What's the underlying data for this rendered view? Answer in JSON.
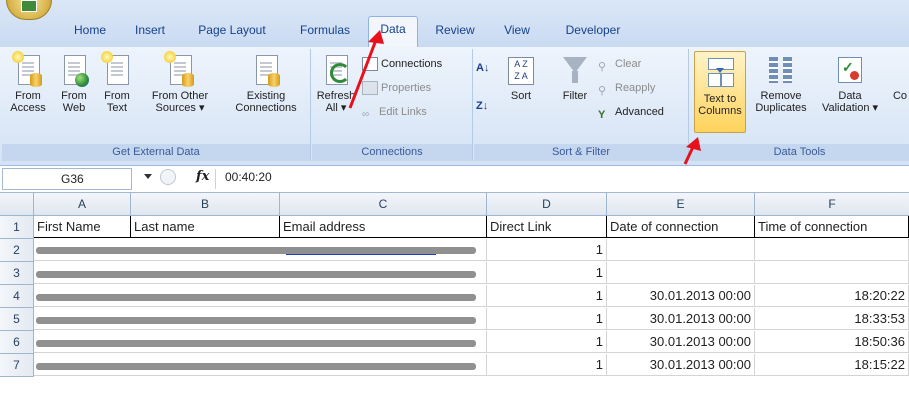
{
  "tabs": [
    "Home",
    "Insert",
    "Page Layout",
    "Formulas",
    "Data",
    "Review",
    "View",
    "Developer"
  ],
  "active_tab": "Data",
  "ribbon": {
    "get_external": {
      "label": "Get External Data",
      "from_access": [
        "From",
        "Access"
      ],
      "from_web": [
        "From",
        "Web"
      ],
      "from_text": [
        "From",
        "Text"
      ],
      "from_other": [
        "From Other",
        "Sources ▾"
      ],
      "existing": [
        "Existing",
        "Connections"
      ]
    },
    "connections": {
      "label": "Connections",
      "refresh": [
        "Refresh",
        "All ▾"
      ],
      "connections": "Connections",
      "properties": "Properties",
      "edit_links": "Edit Links"
    },
    "sort_filter": {
      "label": "Sort & Filter",
      "sort": "Sort",
      "filter": "Filter",
      "clear": "Clear",
      "reapply": "Reapply",
      "advanced": "Advanced"
    },
    "data_tools": {
      "label": "Data Tools",
      "text_to_columns": [
        "Text to",
        "Columns"
      ],
      "remove_duplicates": [
        "Remove",
        "Duplicates"
      ],
      "data_validation": [
        "Data",
        "Validation ▾"
      ],
      "cutoff": "Co"
    }
  },
  "formula_bar": {
    "name_box": "G36",
    "fx": "fx",
    "value": "00:40:20"
  },
  "columns": [
    "A",
    "B",
    "C",
    "D",
    "E",
    "F"
  ],
  "header_row": [
    "First Name",
    "Last name",
    "Email address",
    "Direct Link",
    "Date of connection",
    "Time of connection"
  ],
  "rows": [
    {
      "num": "1"
    },
    {
      "num": "2",
      "d": "1",
      "e": "",
      "f": ""
    },
    {
      "num": "3",
      "d": "1",
      "e": "",
      "f": ""
    },
    {
      "num": "4",
      "d": "1",
      "e": "30.01.2013 00:00",
      "f": "18:20:22"
    },
    {
      "num": "5",
      "d": "1",
      "e": "30.01.2013 00:00",
      "f": "18:33:53"
    },
    {
      "num": "6",
      "d": "1",
      "e": "30.01.2013 00:00",
      "f": "18:50:36"
    },
    {
      "num": "7",
      "d": "1",
      "e": "30.01.2013 00:00",
      "f": "18:15:22"
    }
  ],
  "colors": {
    "accent_arrow": "#e8111b",
    "link": "#1f3fbf"
  }
}
